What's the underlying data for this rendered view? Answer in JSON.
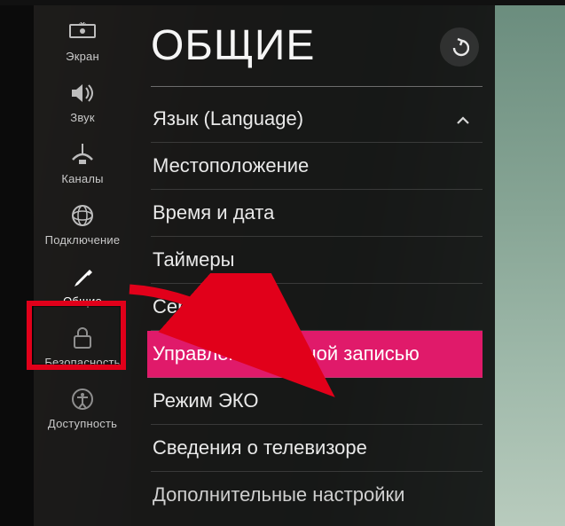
{
  "header": {
    "title": "ОБЩИЕ"
  },
  "sidebar": {
    "items": [
      {
        "label": "Экран",
        "icon": "screen-icon"
      },
      {
        "label": "Звук",
        "icon": "sound-icon"
      },
      {
        "label": "Каналы",
        "icon": "channels-icon"
      },
      {
        "label": "Подключение",
        "icon": "connection-icon"
      },
      {
        "label": "Общие",
        "icon": "general-icon"
      },
      {
        "label": "Безопасность",
        "icon": "security-icon"
      },
      {
        "label": "Доступность",
        "icon": "accessibility-icon"
      }
    ],
    "active_index": 4
  },
  "menu": {
    "items": [
      {
        "label": "Язык (Language)",
        "expanded": true
      },
      {
        "label": "Местоположение"
      },
      {
        "label": "Время и дата"
      },
      {
        "label": "Таймеры"
      },
      {
        "label": "Сервис AI"
      },
      {
        "label": "Управление учетной записью",
        "selected": true
      },
      {
        "label": "Режим ЭКО"
      },
      {
        "label": "Сведения о телевизоре"
      },
      {
        "label": "Дополнительные настройки"
      }
    ]
  },
  "annotation": {
    "highlight_sidebar_index": 4,
    "arrow_color": "#e1001a"
  },
  "colors": {
    "accent": "#e01a6a",
    "highlight_border": "#e1001a"
  }
}
